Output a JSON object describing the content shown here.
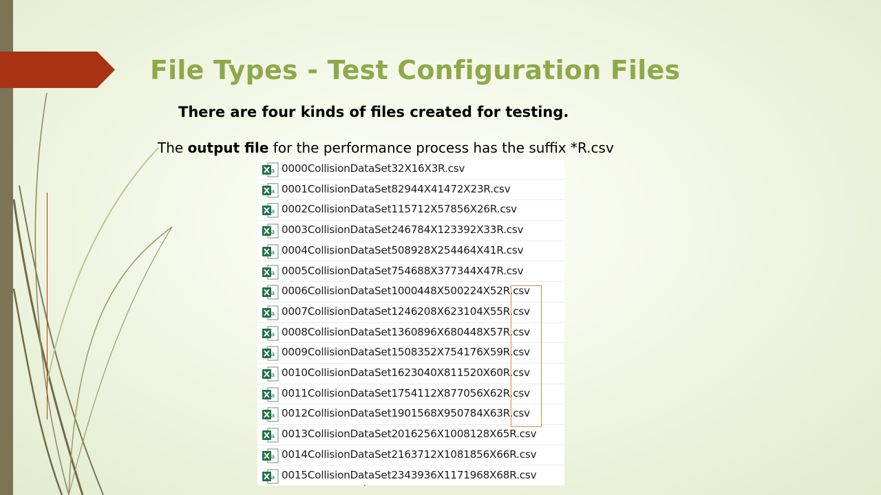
{
  "slide": {
    "title": "File Types - Test Configuration Files",
    "subtitle": "There are four kinds of files created for testing.",
    "description": {
      "prefix": "The ",
      "bold": "output file",
      "suffix": " for the performance process has the suffix *R.csv"
    }
  },
  "files": [
    {
      "name": "0000CollisionDataSet32X16X3R.csv",
      "icon": "excel-csv-icon"
    },
    {
      "name": "0001CollisionDataSet82944X41472X23R.csv",
      "icon": "excel-csv-icon"
    },
    {
      "name": "0002CollisionDataSet115712X57856X26R.csv",
      "icon": "excel-csv-icon"
    },
    {
      "name": "0003CollisionDataSet246784X123392X33R.csv",
      "icon": "excel-csv-icon"
    },
    {
      "name": "0004CollisionDataSet508928X254464X41R.csv",
      "icon": "excel-csv-icon"
    },
    {
      "name": "0005CollisionDataSet754688X377344X47R.csv",
      "icon": "excel-csv-icon"
    },
    {
      "name": "0006CollisionDataSet1000448X500224X52R.csv",
      "icon": "excel-csv-icon"
    },
    {
      "name": "0007CollisionDataSet1246208X623104X55R.csv",
      "icon": "excel-csv-icon"
    },
    {
      "name": "0008CollisionDataSet1360896X680448X57R.csv",
      "icon": "excel-csv-icon"
    },
    {
      "name": "0009CollisionDataSet1508352X754176X59R.csv",
      "icon": "excel-csv-icon"
    },
    {
      "name": "0010CollisionDataSet1623040X811520X60R.csv",
      "icon": "excel-csv-icon"
    },
    {
      "name": "0011CollisionDataSet1754112X877056X62R.csv",
      "icon": "excel-csv-icon"
    },
    {
      "name": "0012CollisionDataSet1901568X950784X63R.csv",
      "icon": "excel-csv-icon"
    },
    {
      "name": "0013CollisionDataSet2016256X1008128X65R.csv",
      "icon": "excel-csv-icon"
    },
    {
      "name": "0014CollisionDataSet2163712X1081856X66R.csv",
      "icon": "excel-csv-icon"
    },
    {
      "name": "0015CollisionDataSet2343936X1171968X68R.csv",
      "icon": "excel-csv-icon"
    }
  ],
  "colors": {
    "title": "#8fa94a",
    "arrow": "#a83214",
    "left_bar": "#7b7456",
    "excel_green": "#1e7145",
    "highlight": "#d98a3a"
  }
}
